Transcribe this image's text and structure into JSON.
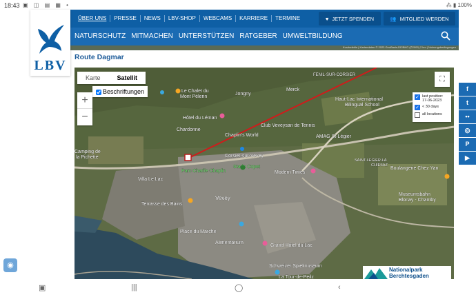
{
  "status_bar": {
    "time": "18:43",
    "battery": "100%"
  },
  "top_nav": {
    "links": [
      "ÜBER UNS",
      "PRESSE",
      "NEWS",
      "LBV-SHOP",
      "WEBCAMS",
      "KARRIERE",
      "TERMINE"
    ],
    "donate": "JETZT SPENDEN",
    "member": "MITGLIED WERDEN"
  },
  "main_nav": {
    "links": [
      "NATURSCHUTZ",
      "MITMACHEN",
      "UNTERSTÜTZEN",
      "RATGEBER",
      "UMWELTBILDUNG"
    ]
  },
  "logo": {
    "text": "LBV"
  },
  "page": {
    "route_title": "Route Dagmar"
  },
  "map": {
    "type_buttons": [
      "Karte",
      "Satellit"
    ],
    "labels_checkbox": "Beschriftungen",
    "zoom_in": "+",
    "zoom_out": "−",
    "attribution": "Kurzbefehle | Kartendaten © 2023 GeoBasis-DE/BKG (©2009)   2 km | Nutzungsbedingungen",
    "legend": [
      {
        "label": "last position: 17-06-2023",
        "checked": true
      },
      {
        "label": "< 30 days",
        "checked": true
      },
      {
        "label": "all locations",
        "checked": false
      }
    ],
    "places": [
      "Le Chalet du Mont Pèlerin",
      "Jongny",
      "Merck",
      "FENIL-SUR-CORSIER",
      "Haut-Lac International Bilingual School",
      "Hôtel du Léman",
      "Chardonne",
      "Chaplin's World",
      "Club Veveysan de Tennis",
      "AMAG St-Légier",
      "Camping de la Pichette",
      "Corsier-sur-Vevey",
      "Parc Charlie Chaplin",
      "Stade Copet",
      "Modern Times",
      "SAINT-LÉGIER-LA CHIÉSAZ",
      "Boulangerie Chez Yan",
      "Villa Le Lac",
      "Terrasse des Bains",
      "Museumsbahn Blonay - Chamby",
      "Vevey",
      "Place du Marché",
      "Alimentarium",
      "Grand Hôtel du Lac",
      "Schweizer Spielmuseum",
      "La Tour-de-Peilz"
    ],
    "park_logo_line1": "Nationalpark",
    "park_logo_line2": "Berchtesgaden"
  },
  "social": [
    "f",
    "t",
    "••",
    "◎",
    "P",
    "▶"
  ]
}
